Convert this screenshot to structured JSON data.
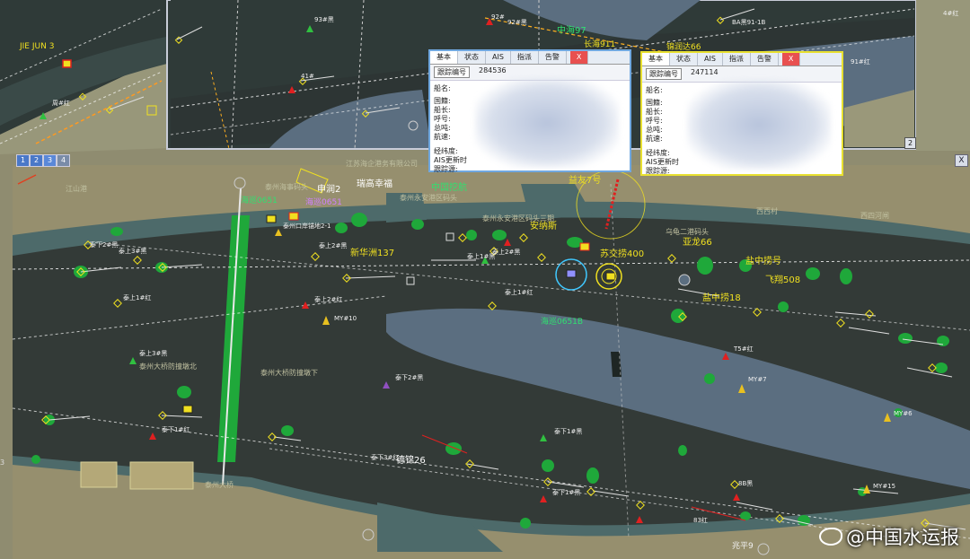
{
  "toolbar": {
    "btn1": "1",
    "btn2": "2",
    "btn3": "3",
    "btn4": "4",
    "close": "X"
  },
  "inset": {
    "label_jiejun": "JIE JUN 3",
    "label_93": "93#黑",
    "label_92": "92#",
    "label_92b": "92#黑",
    "label_ba91": "BA黑91-1B",
    "label_zhonghai": "中海97",
    "label_91": "91#红",
    "label_fuhai": "长海911",
    "label_jinrun": "锦润达66",
    "label_b41": "41#",
    "label_zhouzhi": "周#红",
    "page_num": "2",
    "label_b4": "4#红"
  },
  "popup1": {
    "tabs": [
      "基本",
      "状态",
      "AIS",
      "指派",
      "告警",
      "X"
    ],
    "track_key": "跟踪编号",
    "track_val": "284536",
    "fields": [
      "船名:",
      "国籍:",
      "船长:",
      "呼号:",
      "总吨:",
      "航速:",
      "经纬度:",
      "AIS更新时",
      "跟踪源:"
    ]
  },
  "popup2": {
    "tabs": [
      "基本",
      "状态",
      "AIS",
      "指派",
      "告警",
      "X"
    ],
    "track_key": "跟踪编号",
    "track_val": "247114",
    "fields": [
      "船名:",
      "国籍:",
      "船长:",
      "呼号:",
      "总吨:",
      "航速:",
      "经纬度:",
      "AIS更新时",
      "跟踪源:"
    ]
  },
  "labels": {
    "jiangshan": "江山港",
    "taizhou": "泰州海事码头",
    "shenrun": "申润2",
    "ruigao": "瑞高幸福",
    "jiangsu_co": "江苏海企港务有限公司",
    "zhongguo": "中国挖航",
    "anna": "安纳斯",
    "taizhou_port": "泰州永安港区码头",
    "taizhou_port2": "泰州永安港区码头三期",
    "haixun0651": "海巡0651",
    "haixun06512": "海巡0651",
    "liaoyu": "泰州口岸锚地2-1",
    "xinhuazhou": "新华洲137",
    "taishang2": "泰上2#黑",
    "taishang3": "泰上3#黑",
    "taishang1": "泰上1#红",
    "taishang2h": "泰上2#红",
    "taishang1h": "泰上1#红",
    "taishang2b": "泰上2#黑",
    "taishang1b": "泰上1#黑",
    "yizhen": "益友7号",
    "suijiao": "苏交捞400",
    "yalong": "亚龙66",
    "yanzhong": "盐中捞号",
    "feiyong": "飞翔508",
    "yanzhong18": "盐中捞18",
    "wuma": "乌龟二港码头",
    "xixiang": "西西村",
    "xisi": "西四河闸",
    "myd10": "MY#10",
    "haixun0651b": "海巡0651B",
    "tx5": "T5#红",
    "myh7": "MY#7",
    "myh6": "MY#6",
    "tai_shang3": "泰上3#黑",
    "taizhou_bridge": "泰州大桥",
    "taizhou_bridge2": "泰州大桥防撞墩北",
    "taizhou_bridge3": "泰州大桥防撞墩下",
    "taixia2": "泰下2#黑",
    "taixia1": "泰下1#红",
    "taixia1b": "泰下1#黑",
    "taixia3": "泰下3#红",
    "dejin26": "德锦26",
    "taixia1h": "泰下1#黑",
    "b8": "8B黑",
    "my15": "MY#15",
    "b83": "83红",
    "zhaoping": "兆平9",
    "taixia2b": "泰下2#黑",
    "label_3": "3"
  },
  "watermark": {
    "text": "@中国水运报"
  }
}
